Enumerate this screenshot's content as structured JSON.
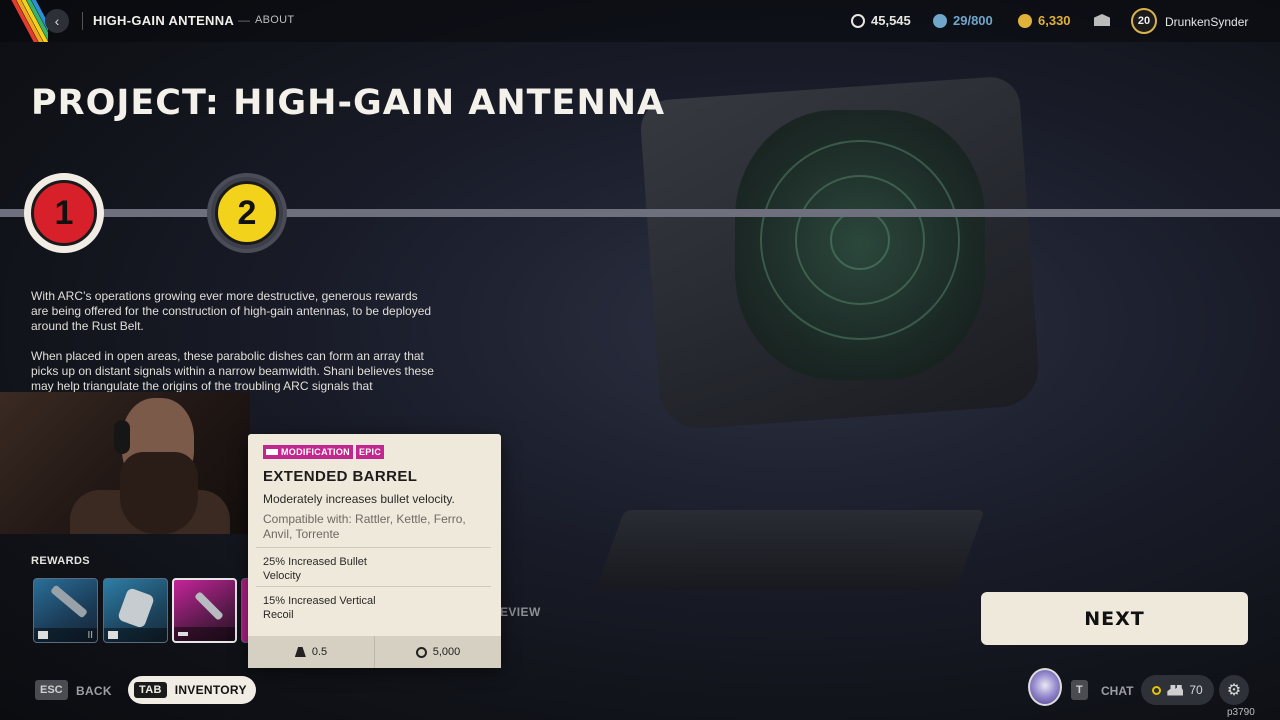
{
  "header": {
    "back_icon": "chevron-left-icon",
    "title": "HIGH-GAIN ANTENNA",
    "dash": "—",
    "subtitle": "ABOUT",
    "currencies": [
      {
        "icon": "coin-icon",
        "value": "45,545",
        "color": "#e8e6e0"
      },
      {
        "icon": "raider-token-icon",
        "value": "29/800",
        "color": "#6fa6c9"
      },
      {
        "icon": "cred-icon",
        "value": "6,330",
        "color": "#e1b23a"
      }
    ],
    "mail_icon": "mail-icon",
    "level": "20",
    "username": "DrunkenSynder"
  },
  "page_title": "PROJECT: HIGH-GAIN ANTENNA",
  "steps": [
    {
      "number": "1",
      "color": "#d8202a",
      "state": "current"
    },
    {
      "number": "2",
      "color": "#f3d21b",
      "state": "upcoming"
    }
  ],
  "description": [
    "With ARC’s operations growing ever more destructive, generous rewards are being offered for the construction of high-gain antennas, to be deployed around the Rust Belt.",
    "When placed in open areas, these parabolic dishes can form an array that picks up on distant signals within a narrow beamwidth. Shani believes these may help triangulate the origins of the troubling ARC signals that"
  ],
  "rewards": {
    "label": "REWARDS",
    "slots": [
      {
        "rarity_color": "#2a6f99",
        "footer_icon": "list-icon",
        "tier": "II"
      },
      {
        "rarity_color": "#2e7ea6",
        "footer_icon": "save-icon",
        "tier": ""
      },
      {
        "rarity_color": "#c5249a",
        "footer_icon": "mod-icon",
        "tier": ""
      }
    ],
    "preview_partial": "EVIEW"
  },
  "tooltip": {
    "tags": [
      "MODIFICATION",
      "EPIC"
    ],
    "tag_color": "#c2268f",
    "title": "EXTENDED BARREL",
    "description": "Moderately increases bullet velocity.",
    "compatible": "Compatible with: Rattler, Kettle, Ferro, Anvil, Torrente",
    "stats": [
      "25% Increased Bullet Velocity",
      "15% Increased Vertical Recoil"
    ],
    "weight": "0.5",
    "price": "5,000"
  },
  "next_button": "NEXT",
  "bottom_bar": {
    "esc_key": "ESC",
    "back_label": "BACK",
    "tab_key": "TAB",
    "inventory_label": "INVENTORY",
    "chat_key": "T",
    "chat_label": "CHAT",
    "friends_count": "70",
    "build": "p3790"
  }
}
